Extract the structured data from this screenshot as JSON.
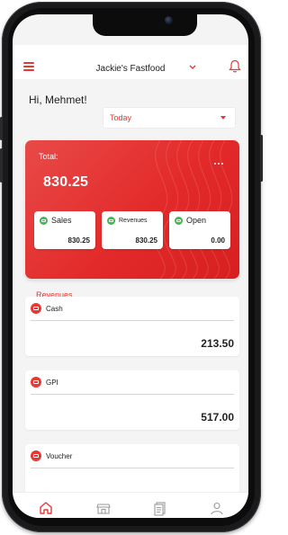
{
  "header": {
    "title": "Jackie's Fastfood"
  },
  "greeting": "Hi, Mehmet!",
  "date_filter": {
    "selected": "Today"
  },
  "summary": {
    "total_label": "Total:",
    "total_value": "830.25",
    "cards": [
      {
        "label": "Sales",
        "value": "830.25",
        "icon": "cash-icon"
      },
      {
        "label": "Revenues",
        "value": "830.25",
        "icon": "cash-icon"
      },
      {
        "label": "Open",
        "value": "0.00",
        "icon": "cash-icon"
      }
    ]
  },
  "revenues": {
    "title": "Revenues",
    "items": [
      {
        "name": "Cash",
        "amount": "213.50",
        "icon": "card-icon"
      },
      {
        "name": "GPI",
        "amount": "517.00",
        "icon": "card-icon"
      },
      {
        "name": "Voucher",
        "amount": "",
        "icon": "card-icon"
      }
    ]
  },
  "tabbar": {
    "items": [
      "home-icon",
      "store-icon",
      "receipt-icon",
      "profile-icon"
    ]
  },
  "colors": {
    "accent": "#e53935",
    "card_gradient": "#e32a2a",
    "positive": "#3fb950"
  }
}
